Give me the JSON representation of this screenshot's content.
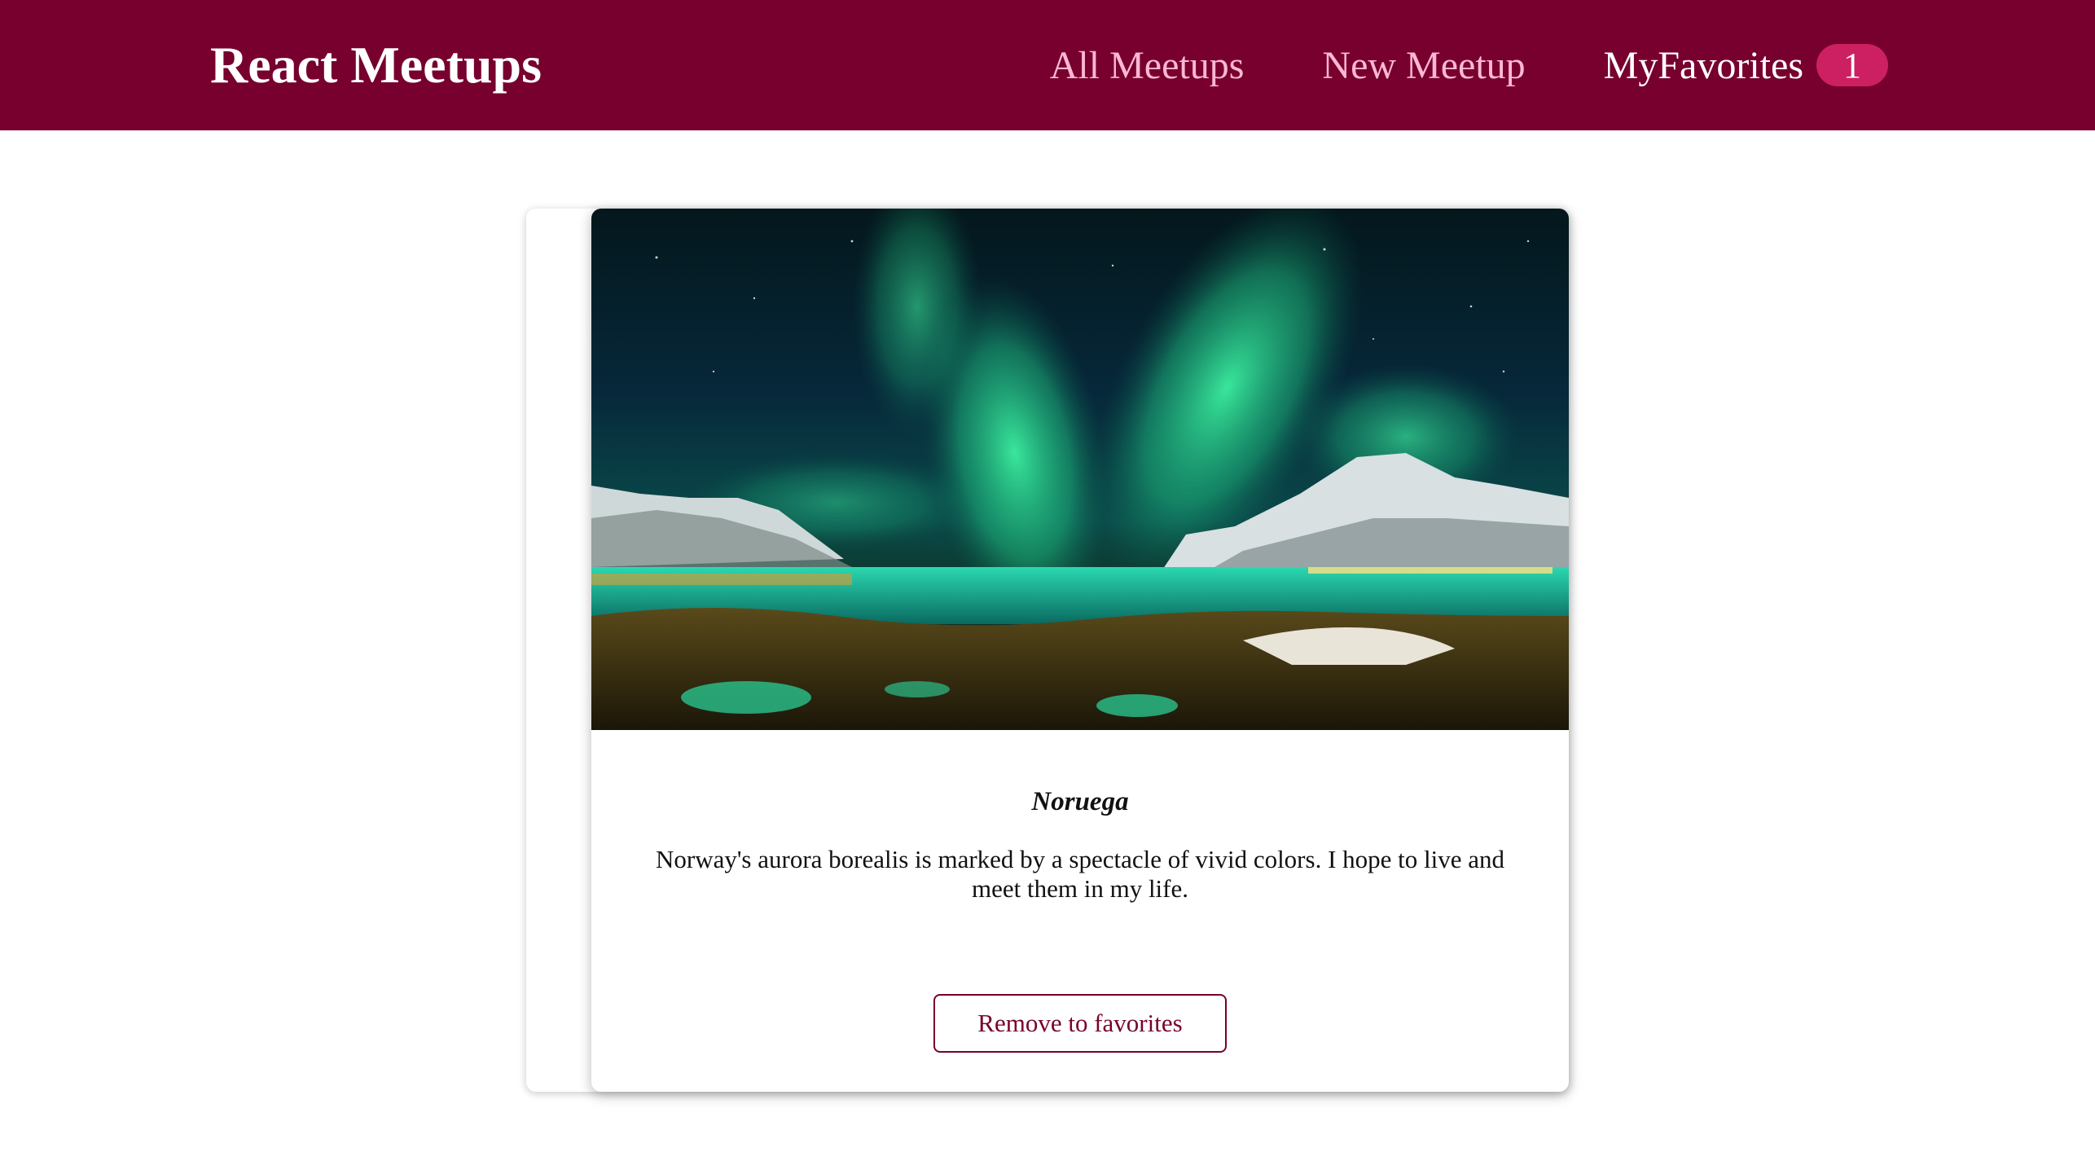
{
  "header": {
    "logo": "React Meetups",
    "nav": {
      "all_meetups": "All Meetups",
      "new_meetup": "New Meetup",
      "my_favorites": "MyFavorites",
      "favorites_count": "1"
    }
  },
  "meetup": {
    "title": "Noruega",
    "description": "Norway's aurora borealis is marked by a spectacle of vivid colors. I hope to live and meet them in my life.",
    "action_label": "Remove to favorites"
  },
  "colors": {
    "brand": "#77002e",
    "badge": "#cc2062",
    "nav_link": "#fcb8d2"
  }
}
